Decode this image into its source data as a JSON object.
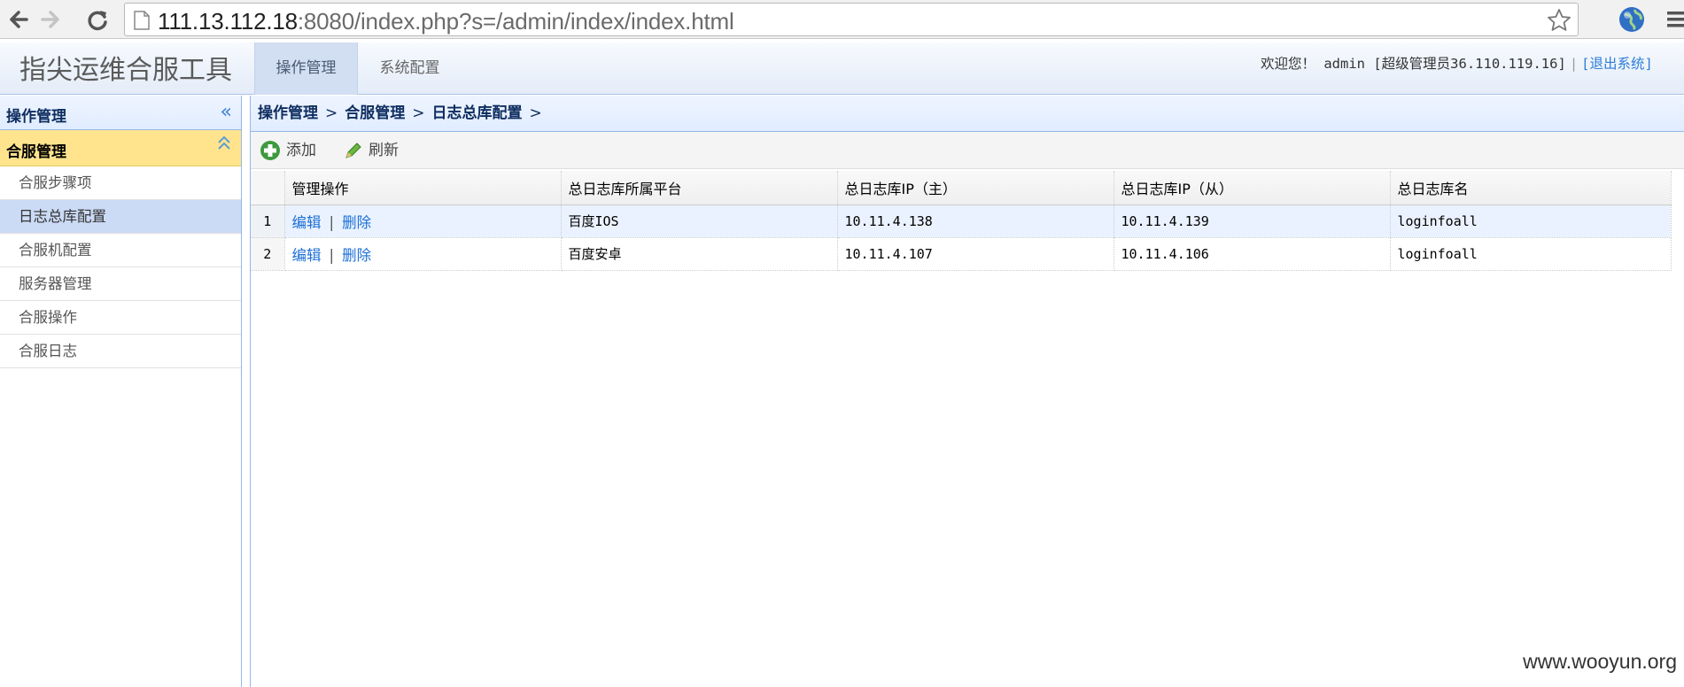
{
  "browser": {
    "url_host": "111.13.112.18",
    "url_rest": ":8080/index.php?s=/admin/index/index.html"
  },
  "header": {
    "app_title": "指尖运维合服工具",
    "tabs": [
      {
        "label": "操作管理",
        "active": true
      },
      {
        "label": "系统配置",
        "active": false
      }
    ],
    "welcome": "欢迎您！ admin [超级管理员36.110.119.16]",
    "separator": "|",
    "logout": "[退出系统]"
  },
  "sidebar": {
    "title": "操作管理",
    "group_title": "合服管理",
    "items": [
      {
        "label": "合服步骤项"
      },
      {
        "label": "日志总库配置",
        "selected": true
      },
      {
        "label": "合服机配置"
      },
      {
        "label": "服务器管理"
      },
      {
        "label": "合服操作"
      },
      {
        "label": "合服日志"
      }
    ]
  },
  "breadcrumb": [
    "操作管理",
    "合服管理",
    "日志总库配置"
  ],
  "breadcrumb_sep": ">",
  "toolbar": {
    "add_label": "添加",
    "refresh_label": "刷新"
  },
  "table": {
    "columns": [
      "管理操作",
      "总日志库所属平台",
      "总日志库IP（主）",
      "总日志库IP（从）",
      "总日志库名"
    ],
    "edit_label": "编辑",
    "delete_label": "删除",
    "action_sep": "|",
    "rows": [
      {
        "num": "1",
        "platform": "百度IOS",
        "ip_master": "10.11.4.138",
        "ip_slave": "10.11.4.139",
        "db_name": "loginfoall"
      },
      {
        "num": "2",
        "platform": "百度安卓",
        "ip_master": "10.11.4.107",
        "ip_slave": "10.11.4.106",
        "db_name": "loginfoall"
      }
    ]
  },
  "watermark": "www.wooyun.org",
  "colors": {
    "accent": "#95b8e7",
    "selected_item": "#cbdaf5",
    "group_header": "#ffe48d",
    "link": "#1c6fd6"
  }
}
